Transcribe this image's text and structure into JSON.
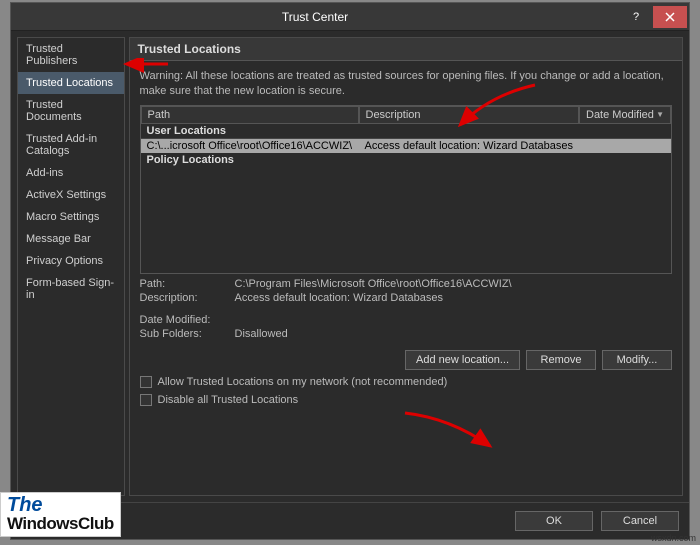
{
  "window": {
    "title": "Trust Center"
  },
  "sidebar": {
    "items": [
      {
        "label": "Trusted Publishers"
      },
      {
        "label": "Trusted Locations"
      },
      {
        "label": "Trusted Documents"
      },
      {
        "label": "Trusted Add-in Catalogs"
      },
      {
        "label": "Add-ins"
      },
      {
        "label": "ActiveX Settings"
      },
      {
        "label": "Macro Settings"
      },
      {
        "label": "Message Bar"
      },
      {
        "label": "Privacy Options"
      },
      {
        "label": "Form-based Sign-in"
      }
    ]
  },
  "main": {
    "header": "Trusted Locations",
    "warning": "Warning: All these locations are treated as trusted sources for opening files. If you change or add a location, make sure that the new location is secure.",
    "columns": {
      "path": "Path",
      "desc": "Description",
      "date": "Date Modified"
    },
    "groups": {
      "user": "User Locations",
      "policy": "Policy Locations"
    },
    "rows": [
      {
        "path": "C:\\...icrosoft Office\\root\\Office16\\ACCWIZ\\",
        "desc": "Access default location: Wizard Databases",
        "date": ""
      }
    ],
    "details": {
      "path_label": "Path:",
      "path_value": "C:\\Program Files\\Microsoft Office\\root\\Office16\\ACCWIZ\\",
      "desc_label": "Description:",
      "desc_value": "Access default location: Wizard Databases",
      "date_label": "Date Modified:",
      "date_value": "",
      "sub_label": "Sub Folders:",
      "sub_value": "Disallowed"
    },
    "buttons": {
      "add": "Add new location...",
      "remove": "Remove",
      "modify": "Modify..."
    },
    "checks": {
      "allow_network": "Allow Trusted Locations on my network (not recommended)",
      "disable_all": "Disable all Trusted Locations"
    }
  },
  "footer": {
    "ok": "OK",
    "cancel": "Cancel"
  },
  "watermark": {
    "l1": "The",
    "l2": "WindowsClub",
    "corner": "wsxdn.com"
  }
}
